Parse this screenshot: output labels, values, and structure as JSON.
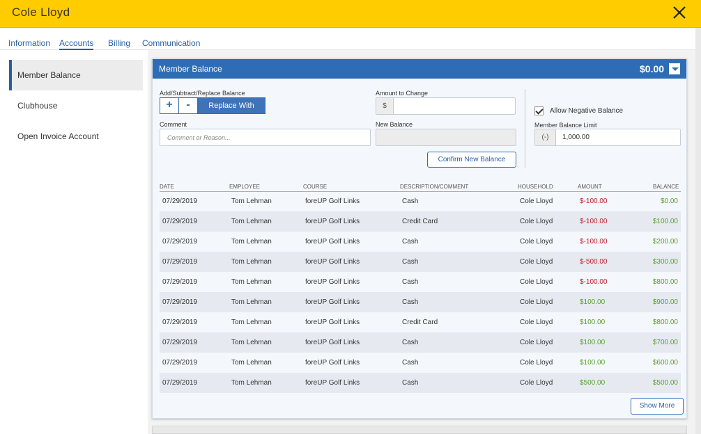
{
  "window": {
    "title": "Cole Lloyd"
  },
  "tabs": [
    {
      "label": "Information"
    },
    {
      "label": "Accounts"
    },
    {
      "label": "Billing"
    },
    {
      "label": "Communication"
    }
  ],
  "sidebar": {
    "items": [
      {
        "label": "Member Balance"
      },
      {
        "label": "Clubhouse"
      },
      {
        "label": "Open Invoice Account"
      }
    ]
  },
  "panel": {
    "title": "Member Balance",
    "balance": "$0.00",
    "add_label": "Add/Subtract/Replace Balance",
    "plus": "+",
    "minus": "-",
    "replace": "Replace With",
    "amount_label": "Amount to Change",
    "amount_prefix": "$",
    "amount_value": "",
    "comment_label": "Comment",
    "comment_placeholder": "Comment or Reason...",
    "new_balance_label": "New Balance",
    "new_balance_value": "",
    "confirm": "Confirm New Balance",
    "allow_negative_label": "Allow Negative Balance",
    "allow_negative_checked": true,
    "limit_label": "Member Balance Limit",
    "limit_prefix": "(-)",
    "limit_value": "1,000.00",
    "show_more": "Show More"
  },
  "table": {
    "headers": [
      "DATE",
      "EMPLOYEE",
      "COURSE",
      "DESCRIPTION/COMMENT",
      "HOUSEHOLD",
      "AMOUNT",
      "BALANCE"
    ],
    "rows": [
      [
        "07/29/2019",
        "Tom Lehman",
        "foreUP Golf Links",
        "Cash",
        "Cole Lloyd",
        "$-100.00",
        "$0.00"
      ],
      [
        "07/29/2019",
        "Tom Lehman",
        "foreUP Golf Links",
        "Credit Card",
        "Cole Lloyd",
        "$-100.00",
        "$100.00"
      ],
      [
        "07/29/2019",
        "Tom Lehman",
        "foreUP Golf Links",
        "Cash",
        "Cole Lloyd",
        "$-100.00",
        "$200.00"
      ],
      [
        "07/29/2019",
        "Tom Lehman",
        "foreUP Golf Links",
        "Cash",
        "Cole Lloyd",
        "$-500.00",
        "$300.00"
      ],
      [
        "07/29/2019",
        "Tom Lehman",
        "foreUP Golf Links",
        "Cash",
        "Cole Lloyd",
        "$-100.00",
        "$800.00"
      ],
      [
        "07/29/2019",
        "Tom Lehman",
        "foreUP Golf Links",
        "Cash",
        "Cole Lloyd",
        "$100.00",
        "$900.00"
      ],
      [
        "07/29/2019",
        "Tom Lehman",
        "foreUP Golf Links",
        "Credit Card",
        "Cole Lloyd",
        "$100.00",
        "$800.00"
      ],
      [
        "07/29/2019",
        "Tom Lehman",
        "foreUP Golf Links",
        "Cash",
        "Cole Lloyd",
        "$100.00",
        "$700.00"
      ],
      [
        "07/29/2019",
        "Tom Lehman",
        "foreUP Golf Links",
        "Cash",
        "Cole Lloyd",
        "$100.00",
        "$600.00"
      ],
      [
        "07/29/2019",
        "Tom Lehman",
        "foreUP Golf Links",
        "Cash",
        "Cole Lloyd",
        "$500.00",
        "$500.00"
      ]
    ]
  },
  "icons": {
    "close": "close-icon",
    "dropdown": "chevron-down-icon",
    "check": "checkbox-checked-icon"
  },
  "colors": {
    "header": "#ffcc00",
    "accent": "#2e6db5",
    "negative": "#c0202e",
    "positive": "#5aa02c"
  }
}
